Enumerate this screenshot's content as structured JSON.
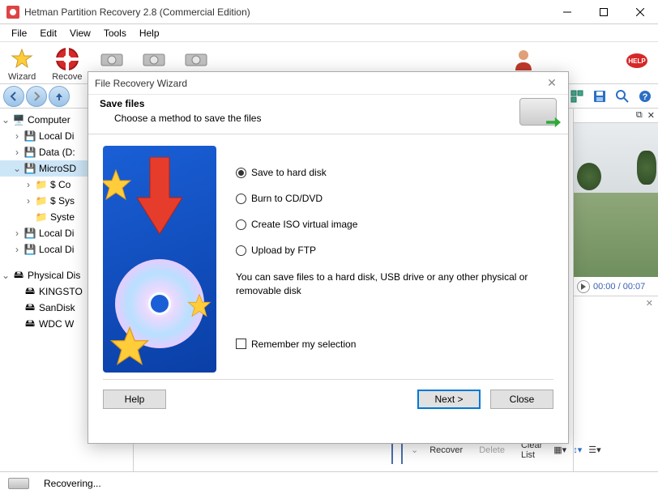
{
  "window": {
    "title": "Hetman Partition Recovery 2.8 (Commercial Edition)"
  },
  "menu": {
    "file": "File",
    "edit": "Edit",
    "view": "View",
    "tools": "Tools",
    "help": "Help"
  },
  "toolbar": {
    "wizard": "Wizard",
    "recover": "Recove"
  },
  "tree": {
    "computer": "Computer",
    "localdi1": "Local Di",
    "data": "Data (D:",
    "microsd": "MicroSD",
    "sco": "$ Co",
    "ssys": "$ Sys",
    "syste": "Syste",
    "localdi2": "Local Di",
    "localdi3": "Local Di",
    "physical": "Physical Dis",
    "kingsto": "KINGSTO",
    "sandisk": "SanDisk",
    "wdcw": "WDC W"
  },
  "player": {
    "time": "00:00 / 00:07"
  },
  "bottom": {
    "recover": "Recover",
    "delete": "Delete",
    "clear": "Clear List"
  },
  "status": {
    "text": "Recovering..."
  },
  "wizard": {
    "title": "File Recovery Wizard",
    "heading": "Save files",
    "sub": "Choose a method to save the files",
    "opt1": "Save to hard disk",
    "opt2": "Burn to CD/DVD",
    "opt3": "Create ISO virtual image",
    "opt4": "Upload by FTP",
    "desc": "You can save files to a hard disk, USB drive or any other physical or removable disk",
    "remember": "Remember my selection",
    "help": "Help",
    "next": "Next  >",
    "close": "Close"
  }
}
